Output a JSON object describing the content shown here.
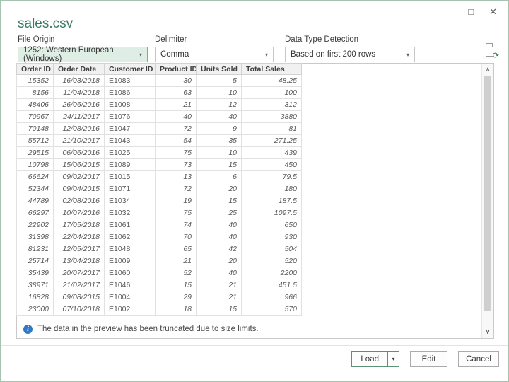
{
  "window": {
    "maximize_icon": "□",
    "close_icon": "✕"
  },
  "title": "sales.csv",
  "form": {
    "file_origin": {
      "label": "File Origin",
      "value": "1252: Western European (Windows)",
      "arrow": "▾"
    },
    "delimiter": {
      "label": "Delimiter",
      "value": "Comma",
      "arrow": "▾"
    },
    "data_type_detection": {
      "label": "Data Type Detection",
      "value": "Based on first 200 rows",
      "arrow": "▾"
    }
  },
  "refresh_icon_glyph": "⟳",
  "scrollbar": {
    "up_glyph": "∧",
    "down_glyph": "∨"
  },
  "table": {
    "columns": [
      "Order ID",
      "Order Date",
      "Customer ID",
      "Product ID",
      "Units Sold",
      "Total Sales"
    ],
    "rows": [
      [
        "15352",
        "16/03/2018",
        "E1083",
        "30",
        "5",
        "48.25"
      ],
      [
        "8156",
        "11/04/2018",
        "E1086",
        "63",
        "10",
        "100"
      ],
      [
        "48406",
        "26/06/2016",
        "E1008",
        "21",
        "12",
        "312"
      ],
      [
        "70967",
        "24/11/2017",
        "E1076",
        "40",
        "40",
        "3880"
      ],
      [
        "70148",
        "12/08/2016",
        "E1047",
        "72",
        "9",
        "81"
      ],
      [
        "55712",
        "21/10/2017",
        "E1043",
        "54",
        "35",
        "271.25"
      ],
      [
        "29515",
        "06/06/2016",
        "E1025",
        "75",
        "10",
        "439"
      ],
      [
        "10798",
        "15/06/2015",
        "E1089",
        "73",
        "15",
        "450"
      ],
      [
        "66624",
        "09/02/2017",
        "E1015",
        "13",
        "6",
        "79.5"
      ],
      [
        "52344",
        "09/04/2015",
        "E1071",
        "72",
        "20",
        "180"
      ],
      [
        "44789",
        "02/08/2016",
        "E1034",
        "19",
        "15",
        "187.5"
      ],
      [
        "66297",
        "10/07/2016",
        "E1032",
        "75",
        "25",
        "1097.5"
      ],
      [
        "22902",
        "17/05/2018",
        "E1061",
        "74",
        "40",
        "650"
      ],
      [
        "31398",
        "22/04/2018",
        "E1062",
        "70",
        "40",
        "930"
      ],
      [
        "81231",
        "12/05/2017",
        "E1048",
        "65",
        "42",
        "504"
      ],
      [
        "25714",
        "13/04/2018",
        "E1009",
        "21",
        "20",
        "520"
      ],
      [
        "35439",
        "20/07/2017",
        "E1060",
        "52",
        "40",
        "2200"
      ],
      [
        "38971",
        "21/02/2017",
        "E1046",
        "15",
        "21",
        "451.5"
      ],
      [
        "16828",
        "09/08/2015",
        "E1004",
        "29",
        "21",
        "966"
      ],
      [
        "23000",
        "07/10/2018",
        "E1002",
        "18",
        "15",
        "570"
      ]
    ]
  },
  "footer": {
    "info_text": "The data in the preview has been truncated due to size limits."
  },
  "buttons": {
    "load": "Load",
    "load_dropdown_icon": "▾",
    "edit": "Edit",
    "cancel": "Cancel"
  },
  "colors": {
    "accent_green": "#217346",
    "title_green": "#3c7b63",
    "file_origin_highlight_bg": "#dfeee5",
    "file_origin_highlight_border": "#7fae91",
    "info_blue": "#2e7ac4"
  }
}
